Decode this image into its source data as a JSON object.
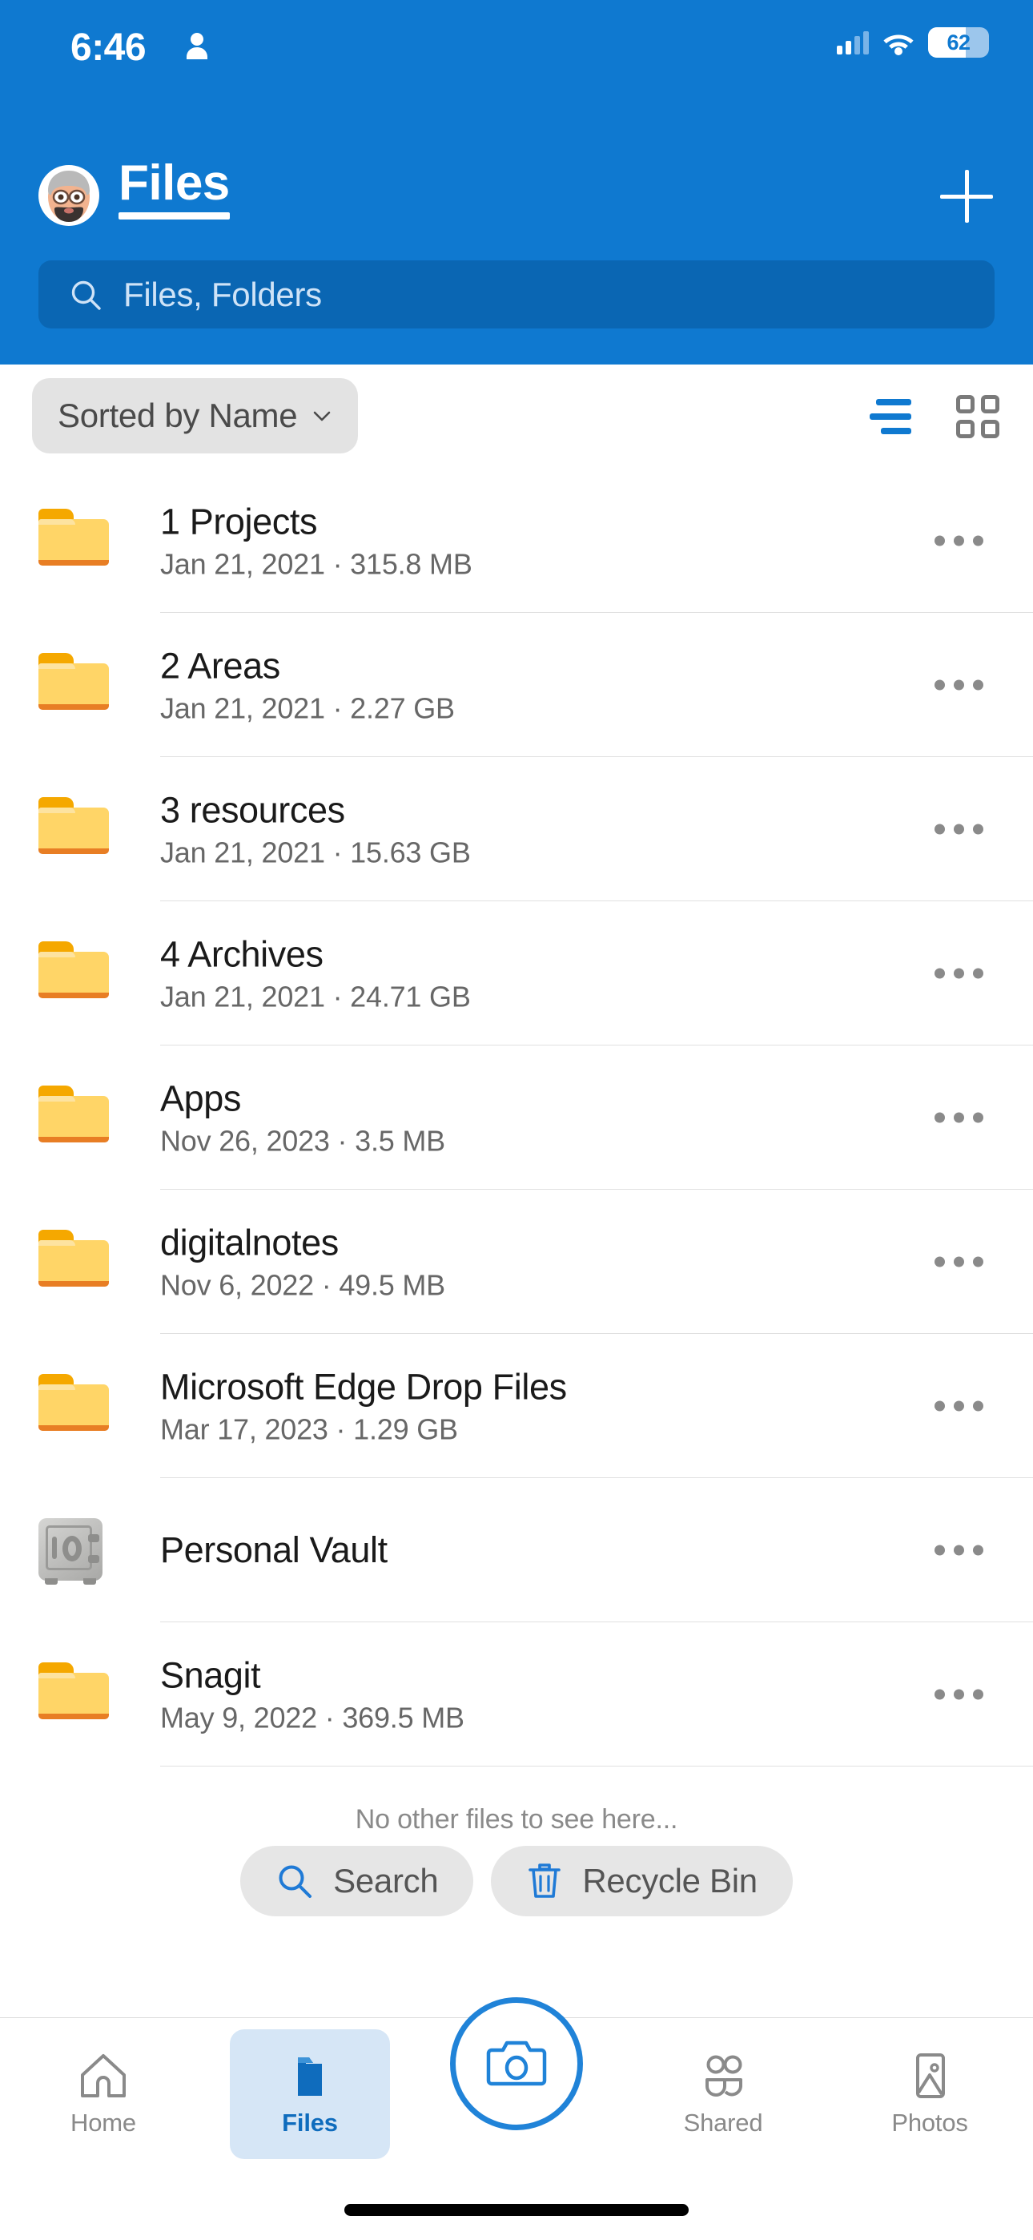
{
  "status_bar": {
    "time": "6:46",
    "battery_percent": "62",
    "icons": [
      "person-icon",
      "cellular-signal-icon",
      "wifi-icon",
      "battery-icon"
    ]
  },
  "header": {
    "title": "Files",
    "avatar": "user-avatar",
    "add_button": "plus-icon",
    "search": {
      "placeholder": "Files, Folders",
      "value": "",
      "icon": "search-icon"
    }
  },
  "toolbar": {
    "sort_label": "Sorted by Name",
    "sort_chevron": "chevron-down-icon",
    "list_view_icon": "list-view-icon",
    "grid_view_icon": "grid-view-icon",
    "active_view": "list",
    "accent_color": "#0f79d0"
  },
  "files": [
    {
      "name": "1 Projects",
      "date": "Jan 21, 2021",
      "size": "315.8 MB",
      "subtitle": "Jan 21, 2021 · 315.8 MB",
      "icon": "folder-icon"
    },
    {
      "name": "2 Areas",
      "date": "Jan 21, 2021",
      "size": "2.27 GB",
      "subtitle": "Jan 21, 2021 · 2.27 GB",
      "icon": "folder-icon"
    },
    {
      "name": "3 resources",
      "date": "Jan 21, 2021",
      "size": "15.63 GB",
      "subtitle": "Jan 21, 2021 · 15.63 GB",
      "icon": "folder-icon"
    },
    {
      "name": "4 Archives",
      "date": "Jan 21, 2021",
      "size": "24.71 GB",
      "subtitle": "Jan 21, 2021 · 24.71 GB",
      "icon": "folder-icon"
    },
    {
      "name": "Apps",
      "date": "Nov 26, 2023",
      "size": "3.5 MB",
      "subtitle": "Nov 26, 2023 · 3.5 MB",
      "icon": "folder-icon"
    },
    {
      "name": "digitalnotes",
      "date": "Nov 6, 2022",
      "size": "49.5 MB",
      "subtitle": "Nov 6, 2022 · 49.5 MB",
      "icon": "folder-icon"
    },
    {
      "name": "Microsoft Edge Drop Files",
      "date": "Mar 17, 2023",
      "size": "1.29 GB",
      "subtitle": "Mar 17, 2023 · 1.29 GB",
      "icon": "folder-icon"
    },
    {
      "name": "Personal Vault",
      "date": "",
      "size": "",
      "subtitle": "",
      "icon": "vault-icon"
    },
    {
      "name": "Snagit",
      "date": "May 9, 2022",
      "size": "369.5 MB",
      "subtitle": "May 9, 2022 · 369.5 MB",
      "icon": "folder-icon"
    }
  ],
  "row_overflow_icon": "more-options-icon",
  "footer": {
    "empty_note": "No other files to see here...",
    "actions": [
      {
        "label": "Search",
        "icon": "search-icon"
      },
      {
        "label": "Recycle Bin",
        "icon": "trash-icon"
      }
    ]
  },
  "tab_bar": {
    "active": "Files",
    "camera_icon": "camera-icon",
    "items": [
      {
        "label": "Home",
        "icon": "home-icon"
      },
      {
        "label": "Files",
        "icon": "folder-filled-icon"
      },
      {
        "label": "Shared",
        "icon": "people-icon"
      },
      {
        "label": "Photos",
        "icon": "photo-icon"
      }
    ]
  }
}
